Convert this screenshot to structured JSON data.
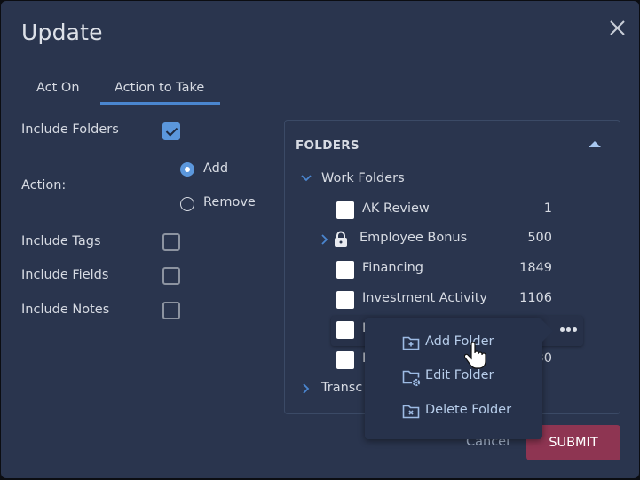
{
  "dialog": {
    "title": "Update",
    "close_icon": "close-icon"
  },
  "tabs": [
    {
      "label": "Act On",
      "active": false
    },
    {
      "label": "Action to Take",
      "active": true
    }
  ],
  "options": {
    "include_folders": {
      "label": "Include Folders",
      "checked": true
    },
    "action": {
      "label": "Action:",
      "choices": [
        {
          "label": "Add",
          "selected": true
        },
        {
          "label": "Remove",
          "selected": false
        }
      ]
    },
    "include_tags": {
      "label": "Include Tags",
      "checked": false
    },
    "include_fields": {
      "label": "Include Fields",
      "checked": false
    },
    "include_notes": {
      "label": "Include Notes",
      "checked": false
    }
  },
  "folders_panel": {
    "title": "FOLDERS",
    "collapse_icon": "caret-up-icon",
    "root": {
      "label": "Work Folders",
      "expanded": true
    },
    "items": [
      {
        "label": "AK Review",
        "count": "1",
        "checked": false
      },
      {
        "label": "Employee Bonus",
        "count": "500",
        "locked": true,
        "expandable": true
      },
      {
        "label": "Financing",
        "count": "1849",
        "checked": false
      },
      {
        "label": "Investment Activity",
        "count": "1106",
        "checked": false
      },
      {
        "label": "I",
        "count": "",
        "checked": false,
        "hovered": true
      },
      {
        "label": "I",
        "count": "30",
        "checked": false
      }
    ],
    "second_root": {
      "label": "Transc",
      "expanded": false
    }
  },
  "context_menu": {
    "items": [
      {
        "label": "Add Folder",
        "icon": "folder-add-icon"
      },
      {
        "label": "Edit Folder",
        "icon": "folder-settings-icon"
      },
      {
        "label": "Delete Folder",
        "icon": "folder-delete-icon"
      }
    ]
  },
  "footer": {
    "cancel_label": "Cancel",
    "submit_label": "SUBMIT"
  },
  "colors": {
    "background": "#2a354e",
    "accent": "#5b97dc",
    "submit": "#8e3552"
  }
}
